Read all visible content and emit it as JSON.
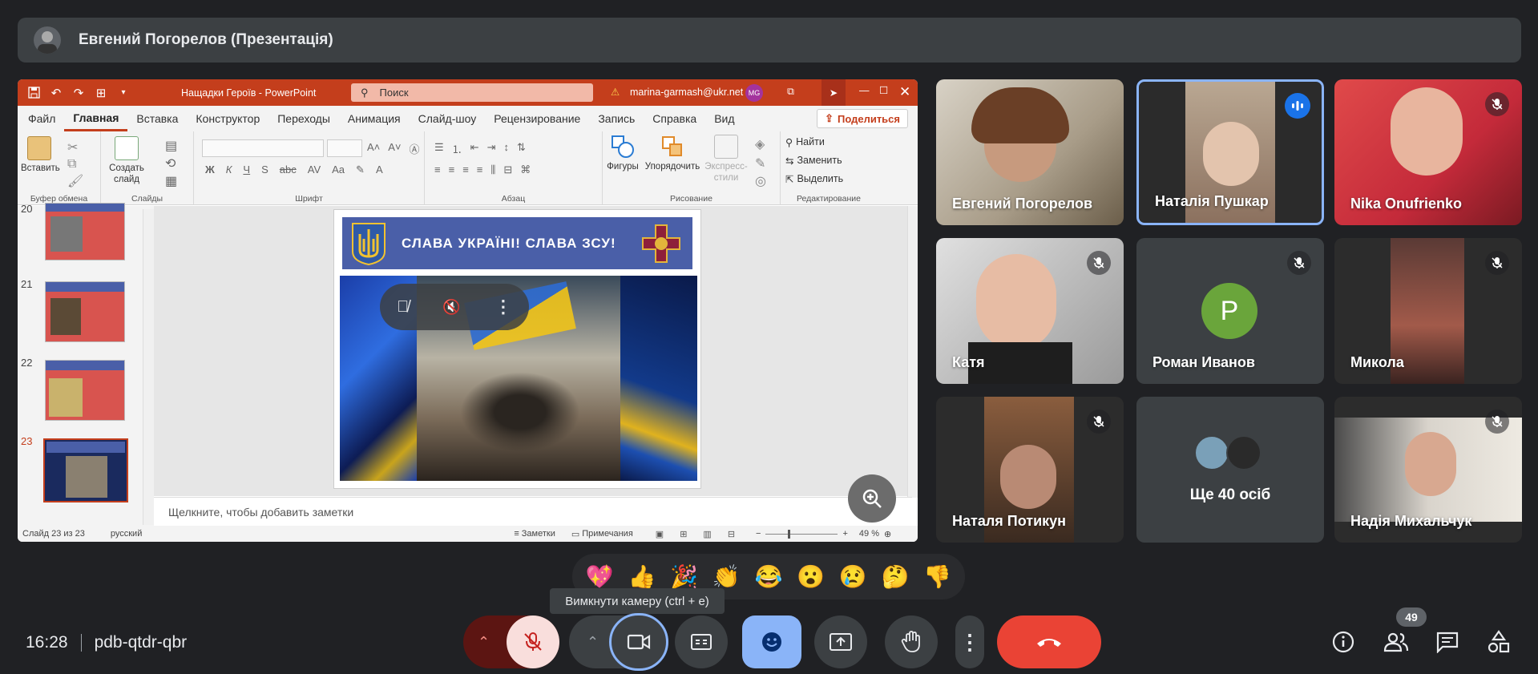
{
  "meet": {
    "presenter_banner": "Евгений Погорелов (Презентація)",
    "time": "16:28",
    "meeting_code": "pdb-qtdr-qbr",
    "camera_tooltip": "Вимкнути камеру (ctrl + e)",
    "participants_badge": "49",
    "reactions": [
      "💖",
      "👍",
      "🎉",
      "👏",
      "😂",
      "😮",
      "😢",
      "🤔",
      "👎"
    ]
  },
  "powerpoint": {
    "doc_title": "Нащадки Героїв  -  PowerPoint",
    "search_placeholder": "Поиск",
    "account": "marina-garmash@ukr.net",
    "account_initials": "MG",
    "tabs": [
      "Файл",
      "Главная",
      "Вставка",
      "Конструктор",
      "Переходы",
      "Анимация",
      "Слайд-шоу",
      "Рецензирование",
      "Запись",
      "Справка",
      "Вид"
    ],
    "share_label": "Поделиться",
    "ribbon": {
      "paste": "Вставить",
      "clipboard_group": "Буфер обмена",
      "new_slide": "Создать слайд",
      "slides_group": "Слайды",
      "font_group": "Шрифт",
      "paragraph_group": "Абзац",
      "shapes": "Фигуры",
      "arrange": "Упорядочить",
      "quick_styles": "Экспресс-стили",
      "drawing_group": "Рисование",
      "find": "Найти",
      "replace": "Заменить",
      "select": "Выделить",
      "editing_group": "Редактирование"
    },
    "thumb_numbers": [
      "20",
      "21",
      "22",
      "23"
    ],
    "slide_banner": "СЛАВА УКРАЇНІ! СЛАВА ЗСУ!",
    "notes_placeholder": "Щелкните, чтобы добавить заметки",
    "status_slide": "Слайд 23 из 23",
    "status_lang": "русский",
    "status_notes": "Заметки",
    "status_comments": "Примечания",
    "zoom_level": "49 %"
  },
  "participants": [
    {
      "name": "Евгений Погорелов",
      "muted": false
    },
    {
      "name": "Наталія Пушкар",
      "muted": false,
      "speaking": true
    },
    {
      "name": "Nika Onufrienko",
      "muted": true
    },
    {
      "name": "Катя",
      "muted": true
    },
    {
      "name": "Роман Иванов",
      "muted": true,
      "initial": "P"
    },
    {
      "name": "Микола",
      "muted": true
    },
    {
      "name": "Наталя Потикун",
      "muted": true
    },
    {
      "name": "Ще 40 осіб",
      "muted": false
    },
    {
      "name": "Надія Михальчук",
      "muted": true
    }
  ],
  "colors": {
    "background": "#202124",
    "ppt_accent": "#c43e1c",
    "end_call": "#ea4335",
    "emoji_button": "#8ab4f8",
    "avatar_green": "#6aa53b"
  }
}
